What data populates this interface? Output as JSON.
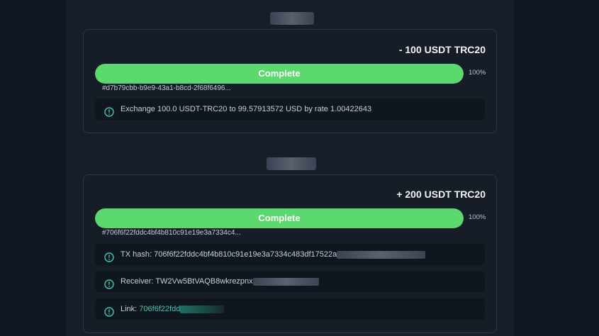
{
  "colors": {
    "page_bg": "#121821",
    "column_bg": "#171e28",
    "card_bg": "#161d27",
    "progress_fill": "#5cd96e",
    "info_icon": "#3fc7b1",
    "link": "#3fc7b1"
  },
  "transactions": [
    {
      "amount": "- 100 USDT TRC20",
      "status_label": "Complete",
      "progress": 1.0,
      "progress_text": "100%",
      "hash_short": "#d7b79cbb-b9e9-43a1-b8cd-2f68f6496...",
      "details": [
        {
          "icon": "info-icon",
          "text": "Exchange 100.0 USDT-TRC20 to 99.57913572 USD by rate 1.00422643"
        }
      ]
    },
    {
      "amount": "+ 200 USDT TRC20",
      "status_label": "Complete",
      "progress": 1.0,
      "progress_text": "100%",
      "hash_short": "#706f6f22fddc4bf4b810c91e19e3a7334c4...",
      "details": [
        {
          "icon": "info-icon",
          "label": "TX hash: ",
          "value": "706f6f22fddc4bf4b810c91e19e3a7334c483df17522a"
        },
        {
          "icon": "info-icon",
          "label": "Receiver: ",
          "value": "TW2Vw5BtVAQB8wkrezpnx"
        },
        {
          "icon": "info-icon",
          "label": "Link: ",
          "value": "706f6f22fdd"
        }
      ]
    }
  ]
}
